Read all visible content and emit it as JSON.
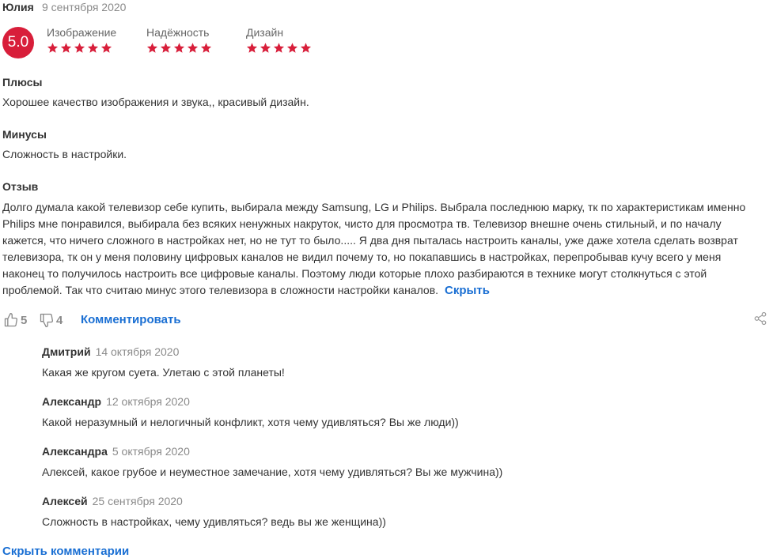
{
  "review": {
    "author": "Юлия",
    "date": "9 сентября 2020",
    "rating": "5.0",
    "criteria": [
      {
        "label": "Изображение",
        "stars": 5
      },
      {
        "label": "Надёжность",
        "stars": 5
      },
      {
        "label": "Дизайн",
        "stars": 5
      }
    ],
    "pros_title": "Плюсы",
    "pros_text": "Хорошее качество изображения и звука,, красивый дизайн.",
    "cons_title": "Минусы",
    "cons_text": "Сложность в настройки.",
    "body_title": "Отзыв",
    "body_text": "Долго думала какой телевизор себе купить, выбирала между Samsung, LG и Philips. Выбрала последнюю марку, тк по характеристикам именно Philips мне понравился, выбирала без всяких ненужных накруток, чисто для просмотра тв. Телевизор внешне очень стильный, и по началу кажется, что ничего сложного в настройках нет, но не тут то было..... Я два дня пыталась настроить каналы, уже даже хотела сделать возврат телевизора, тк он у меня половину цифровых каналов не видил почему то, но покапавшись в настройках, перепробывав кучу всего у меня наконец то получилось настроить все цифровые каналы. Поэтому люди которые плохо разбираются в технике могут столкнуться с этой проблемой. Так что считаю минус этого телевизора в сложности настройки каналов.",
    "hide_label": "Скрыть",
    "likes": "5",
    "dislikes": "4",
    "comment_label": "Комментировать",
    "star_color": "#d81e3a"
  },
  "comments": [
    {
      "author": "Дмитрий",
      "date": "14 октября 2020",
      "text": "Какая же кругом суета. Улетаю с этой планеты!"
    },
    {
      "author": "Александр",
      "date": "12 октября 2020",
      "text": "Какой неразумный и нелогичный конфликт, хотя чему удивляться? Вы же люди))"
    },
    {
      "author": "Александра",
      "date": "5 октября 2020",
      "text": "Алексей, какое грубое и неуместное замечание, хотя чему удивляться? Вы же мужчина))"
    },
    {
      "author": "Алексей",
      "date": "25 сентября 2020",
      "text": "Сложность в настройках, чему удивляться? ведь вы же женщина))"
    }
  ],
  "hide_comments_label": "Скрыть комментарии"
}
